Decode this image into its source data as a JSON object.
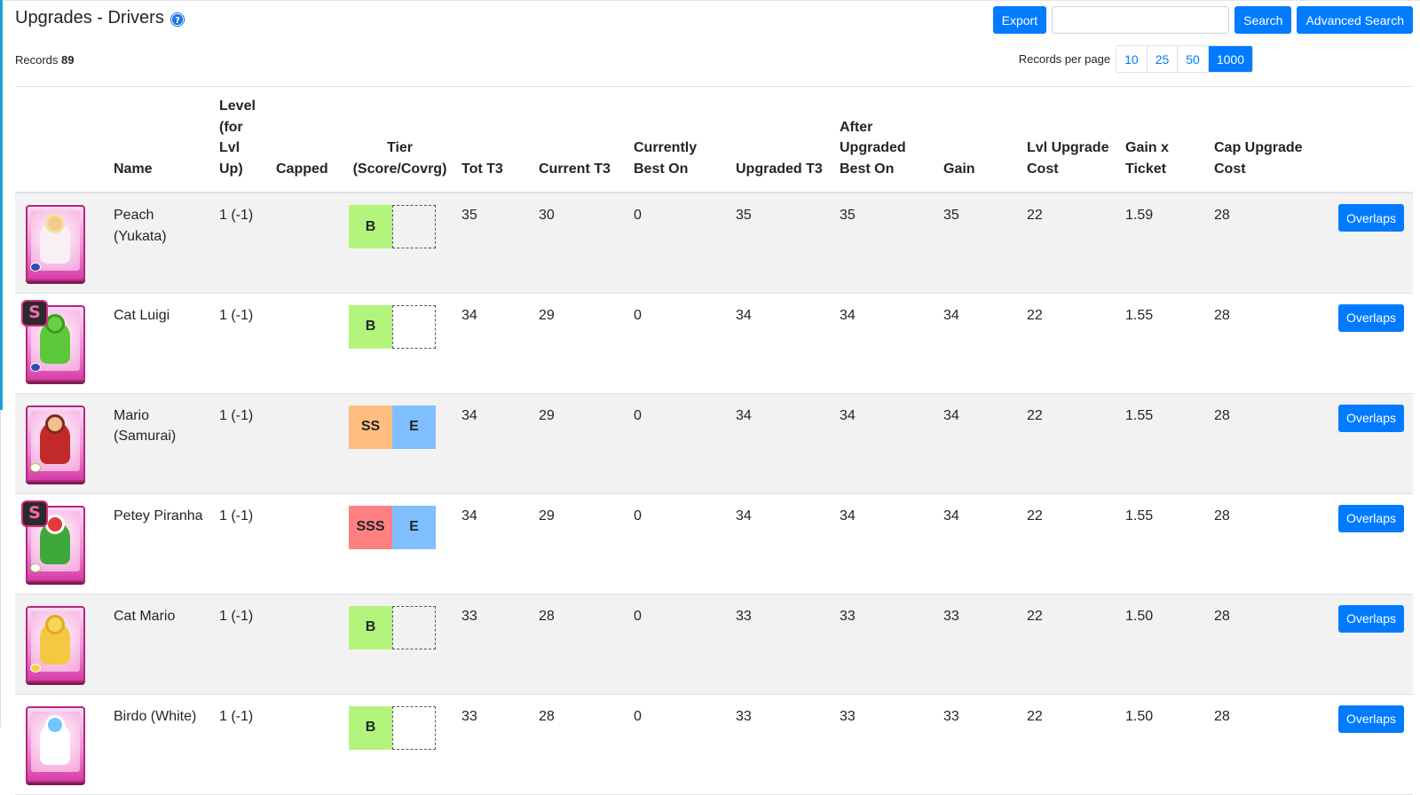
{
  "page": {
    "title": "Upgrades - Drivers",
    "records_label": "Records",
    "records_count": "89"
  },
  "toolbar": {
    "export_label": "Export",
    "search_value": "",
    "search_placeholder": "",
    "search_label": "Search",
    "advanced_search_label": "Advanced Search"
  },
  "pagination": {
    "label": "Records per page",
    "options": [
      "10",
      "25",
      "50",
      "1000"
    ],
    "selected": "1000"
  },
  "table": {
    "headers": {
      "image": "",
      "name": "Name",
      "level": "Level (for Lvl Up)",
      "capped": "Capped",
      "tier": "Tier (Score/Covrg)",
      "tot_t3": "Tot T3",
      "current_t3": "Current T3",
      "currently_best_on": "Currently Best On",
      "upgraded_t3": "Upgraded T3",
      "after_upgraded_best_on": "After Upgraded Best On",
      "gain": "Gain",
      "lvl_upgrade_cost": "Lvl Upgrade Cost",
      "gain_x_ticket": "Gain x Ticket",
      "cap_upgrade_cost": "Cap Upgrade Cost",
      "actions": ""
    },
    "overlaps_label": "Overlaps",
    "rows": [
      {
        "name": "Peach (Yukata)",
        "level": "1 (-1)",
        "capped": "",
        "tier_score": "B",
        "tier_cov": "",
        "tot_t3": "35",
        "current_t3": "30",
        "currently_best_on": "0",
        "upgraded_t3": "35",
        "after_upgraded_best_on": "35",
        "gain": "35",
        "lvl_upgrade_cost": "22",
        "gain_x_ticket": "1.59",
        "cap_upgrade_cost": "28"
      },
      {
        "name": "Cat Luigi",
        "level": "1 (-1)",
        "capped": "",
        "tier_score": "B",
        "tier_cov": "",
        "tot_t3": "34",
        "current_t3": "29",
        "currently_best_on": "0",
        "upgraded_t3": "34",
        "after_upgraded_best_on": "34",
        "gain": "34",
        "lvl_upgrade_cost": "22",
        "gain_x_ticket": "1.55",
        "cap_upgrade_cost": "28"
      },
      {
        "name": "Mario (Samurai)",
        "level": "1 (-1)",
        "capped": "",
        "tier_score": "SS",
        "tier_cov": "E",
        "tot_t3": "34",
        "current_t3": "29",
        "currently_best_on": "0",
        "upgraded_t3": "34",
        "after_upgraded_best_on": "34",
        "gain": "34",
        "lvl_upgrade_cost": "22",
        "gain_x_ticket": "1.55",
        "cap_upgrade_cost": "28"
      },
      {
        "name": "Petey Piranha",
        "level": "1 (-1)",
        "capped": "",
        "tier_score": "SSS",
        "tier_cov": "E",
        "tot_t3": "34",
        "current_t3": "29",
        "currently_best_on": "0",
        "upgraded_t3": "34",
        "after_upgraded_best_on": "34",
        "gain": "34",
        "lvl_upgrade_cost": "22",
        "gain_x_ticket": "1.55",
        "cap_upgrade_cost": "28"
      },
      {
        "name": "Cat Mario",
        "level": "1 (-1)",
        "capped": "",
        "tier_score": "B",
        "tier_cov": "",
        "tot_t3": "33",
        "current_t3": "28",
        "currently_best_on": "0",
        "upgraded_t3": "33",
        "after_upgraded_best_on": "33",
        "gain": "33",
        "lvl_upgrade_cost": "22",
        "gain_x_ticket": "1.50",
        "cap_upgrade_cost": "28"
      },
      {
        "name": "Birdo (White)",
        "level": "1 (-1)",
        "capped": "",
        "tier_score": "B",
        "tier_cov": "",
        "tot_t3": "33",
        "current_t3": "28",
        "currently_best_on": "0",
        "upgraded_t3": "33",
        "after_upgraded_best_on": "33",
        "gain": "33",
        "lvl_upgrade_cost": "22",
        "gain_x_ticket": "1.50",
        "cap_upgrade_cost": "28"
      }
    ]
  },
  "colors": {
    "primary": "#007bff",
    "tier_B": "#b3f57c",
    "tier_SS": "#ffbd7f",
    "tier_SSS": "#ff8080",
    "tier_E": "#80bfff",
    "row_stripe": "#f2f2f2",
    "accent_bar": "#17a2d8"
  },
  "icons": {
    "help": "question-circle-icon",
    "tier_badge": "s-rank-badge-icon"
  }
}
